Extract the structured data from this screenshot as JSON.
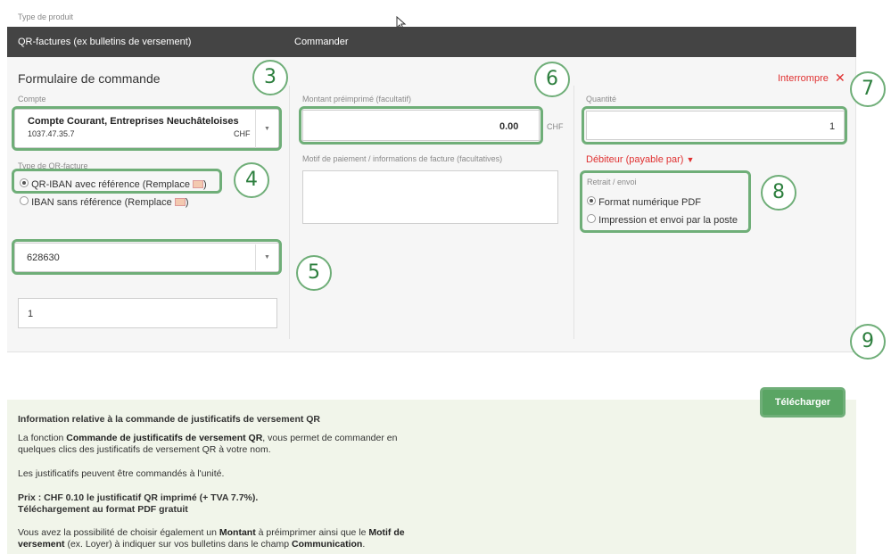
{
  "header": {
    "product_type_label": "Type de produit",
    "product_value": "QR-factures (ex bulletins de versement)",
    "order_label": "Commander"
  },
  "form": {
    "title": "Formulaire de commande",
    "cancel_label": "Interrompre",
    "account": {
      "label": "Compte",
      "name": "Compte Courant, Entreprises Neuchâteloises",
      "number": "1037.47.35.7",
      "currency": "CHF"
    },
    "qr_type": {
      "label": "Type de QR-facture",
      "options": [
        {
          "label": "QR-IBAN avec référence (Remplace",
          "selected": true
        },
        {
          "label": "IBAN sans référence (Remplace",
          "selected": false
        }
      ],
      "close_paren": ")"
    },
    "reference_select": {
      "value": "628630"
    },
    "extra_input": {
      "value": "1"
    },
    "amount": {
      "label": "Montant préimprimé (facultatif)",
      "value": "0.00",
      "currency": "CHF"
    },
    "motive": {
      "label": "Motif de paiement / informations de facture (facultatives)",
      "value": ""
    },
    "quantity": {
      "label": "Quantité",
      "value": "1"
    },
    "debtor_label": "Débiteur (payable par)",
    "delivery": {
      "label": "Retrait / envoi",
      "options": [
        {
          "label": "Format numérique PDF",
          "selected": true
        },
        {
          "label": "Impression et envoi par la poste",
          "selected": false
        }
      ]
    },
    "download_label": "Télécharger"
  },
  "callouts": [
    "3",
    "4",
    "5",
    "6",
    "7",
    "8",
    "9"
  ],
  "info": {
    "title": "Information relative à la commande de justificatifs de versement QR",
    "p1_a": "La fonction ",
    "p1_b": "Commande de justificatifs de versement QR",
    "p1_c": ", vous permet de commander en",
    "p1_d": "quelques clics des justificatifs de versement QR à votre nom.",
    "p2": "Les justificatifs peuvent être commandés à l'unité.",
    "price_1": "Prix : CHF 0.10 le justificatif QR imprimé (+ TVA 7.7%).",
    "price_2": "Téléchargement au format PDF gratuit",
    "p3_a": "Vous avez la possibilité de choisir également un ",
    "p3_b": "Montant",
    "p3_c": " à préimprimer ainsi que le ",
    "p3_d": "Motif de",
    "p3_e": "versement",
    "p3_f": " (ex. Loyer) à indiquer sur vos bulletins dans le champ ",
    "p3_g": "Communication",
    "p3_h": "."
  },
  "colors": {
    "accent_green": "#6fae78",
    "button_green": "#5aa564",
    "alert_red": "#e03131",
    "topbar": "#444444"
  }
}
